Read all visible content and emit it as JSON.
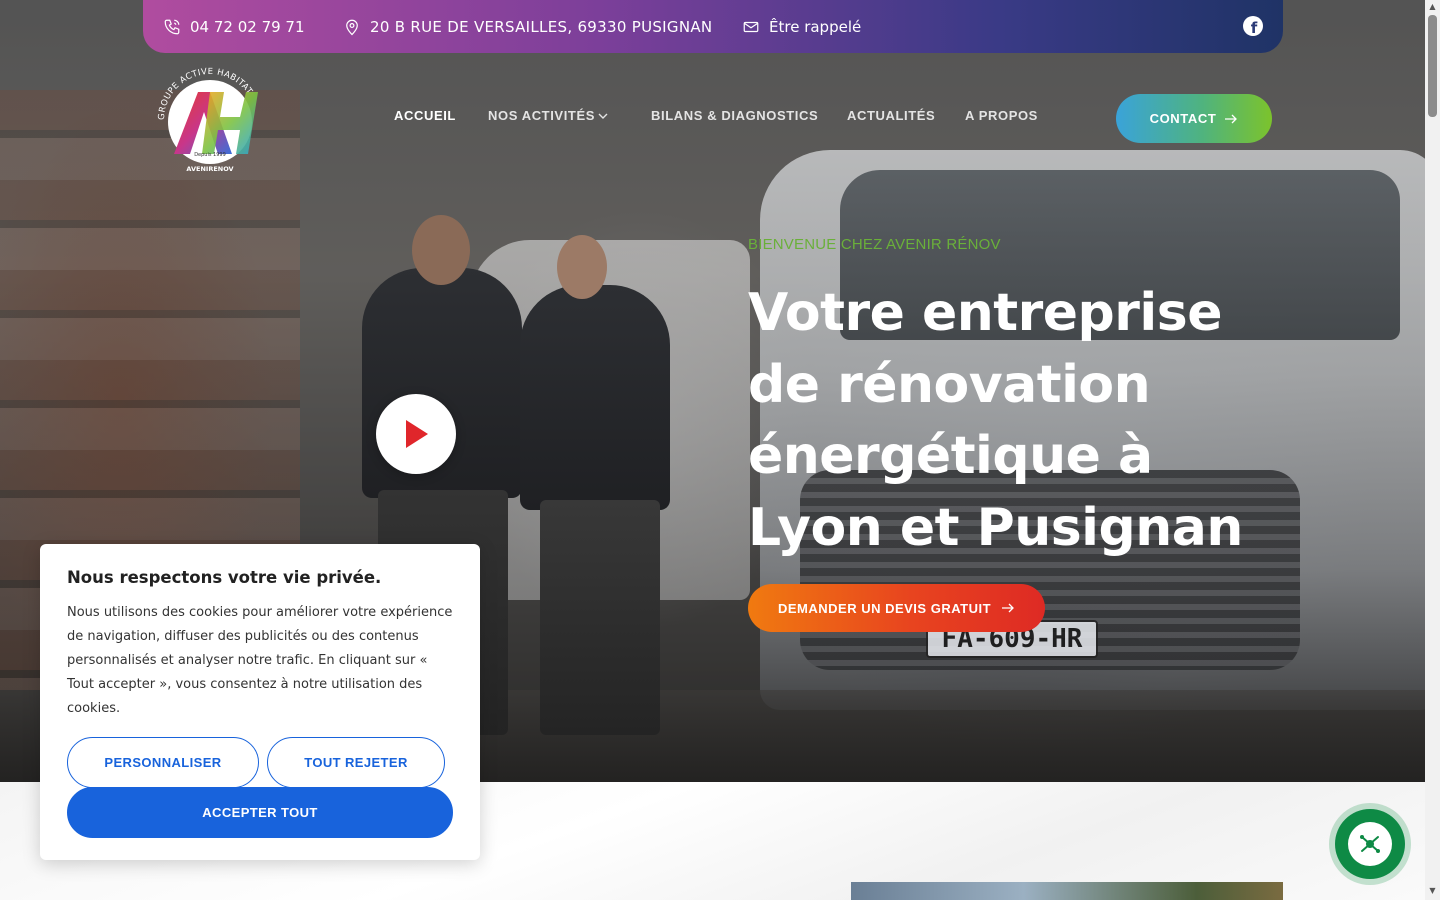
{
  "topbar": {
    "phone": "04 72 02 79 71",
    "address": "20 B RUE DE VERSAILLES, 69330 PUSIGNAN",
    "callback": "Être rappelé",
    "social": "facebook-icon"
  },
  "logo": {
    "arc_text": "GROUPE ACTIVE HABITAT",
    "since": "Depuis 1999",
    "brand": "AVENIRENOV"
  },
  "nav": {
    "items": [
      {
        "label": "ACCUEIL",
        "active": true
      },
      {
        "label": "NOS ACTIVITÉS",
        "has_dropdown": true
      },
      {
        "label": "BILANS & DIAGNOSTICS"
      },
      {
        "label": "ACTUALITÉS"
      },
      {
        "label": "A PROPOS"
      }
    ],
    "contact_label": "CONTACT"
  },
  "hero": {
    "eyebrow": "BIENVENUE CHEZ AVENIR RÉNOV",
    "headline_lines": [
      "Votre entreprise",
      "de rénovation",
      "énergétique à",
      "Lyon et Pusignan"
    ],
    "cta_label": "DEMANDER UN DEVIS GRATUIT",
    "plate_text": "FA-609-HR"
  },
  "cookie": {
    "title": "Nous respectons votre vie privée.",
    "body": "Nous utilisons des cookies pour améliorer votre expérience de navigation, diffuser des publicités ou des contenus personnalisés et analyser notre trafic. En cliquant sur « Tout accepter », vous consentez à notre utilisation des cookies.",
    "customize_label": "PERSONNALISER",
    "reject_label": "TOUT REJETER",
    "accept_label": "ACCEPTER TOUT"
  },
  "colors": {
    "accent_green": "#6ab03a",
    "cookie_blue": "#1863dc",
    "chat_green": "#0e8a45"
  }
}
